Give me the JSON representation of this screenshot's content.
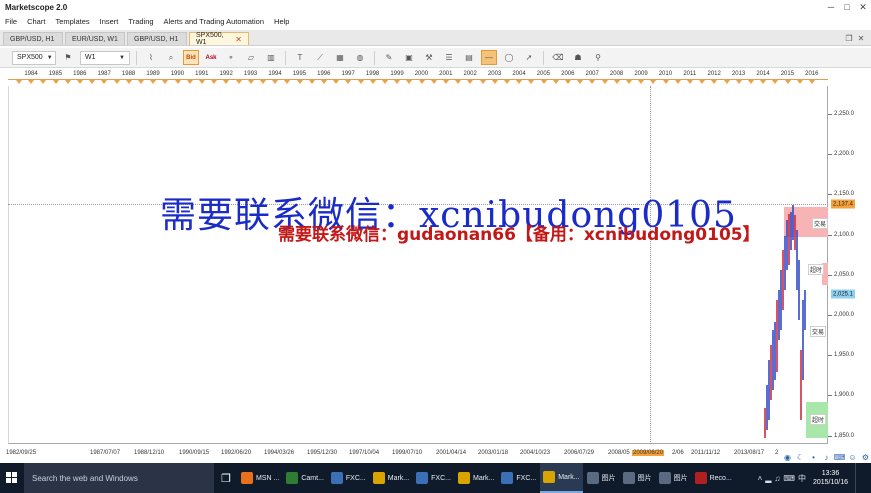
{
  "window": {
    "title": "Marketscope 2.0",
    "controls": [
      "─",
      "□",
      "✕"
    ]
  },
  "menu": [
    "File",
    "Chart",
    "Templates",
    "Insert",
    "Trading",
    "Alerts and Trading Automation",
    "Help"
  ],
  "tabs": [
    {
      "label": "GBP/USD, H1",
      "active": false
    },
    {
      "label": "EUR/USD, W1",
      "active": false
    },
    {
      "label": "GBP/USD, H1",
      "active": false
    },
    {
      "label": "SPX500, W1",
      "active": true
    }
  ],
  "tab_close_glyph": "✕",
  "toolbar": {
    "instrument": "SPX500",
    "timeframe": "W1",
    "bid_label": "Bid",
    "ask_label": "Ask"
  },
  "year_axis": [
    "1984",
    "1985",
    "1986",
    "1987",
    "1988",
    "1989",
    "1990",
    "1991",
    "1992",
    "1993",
    "1994",
    "1995",
    "1996",
    "1997",
    "1998",
    "1999",
    "2000",
    "2001",
    "2002",
    "2003",
    "2004",
    "2005",
    "2006",
    "2007",
    "2008",
    "2009",
    "2010",
    "2011",
    "2012",
    "2013",
    "2014",
    "2015",
    "2016"
  ],
  "price_axis": [
    "2,250.0",
    "2,200.0",
    "2,150.0",
    "2,100.0",
    "2,050.0",
    "2,000.0",
    "1,950.0",
    "1,900.0",
    "1,850.0"
  ],
  "price_flags": {
    "high": "2,137.4",
    "current": "2,025.1"
  },
  "date_axis": [
    "1982/09/25",
    "1987/07/07",
    "1988/12/10",
    "1990/09/15",
    "1992/06/20",
    "1994/03/26",
    "1995/12/30",
    "1997/10/04",
    "1999/07/10",
    "2001/04/14",
    "2003/01/18",
    "2004/10/23",
    "2006/07/29",
    "2008/05",
    "2009/06/20",
    "2/06",
    "2011/11/12",
    "2013/08/17",
    "2"
  ],
  "side_tags": [
    "交易",
    "超时",
    "交易",
    "超时"
  ],
  "watermark_blue": "需要联系微信：xcnibudong0105",
  "watermark_red": "需要联系微信：gudaonan66【备用：xcnibudong0105】",
  "taskbar": {
    "search_placeholder": "Search the web and Windows",
    "apps": [
      {
        "label": "MSN ...",
        "color": "#e9711c",
        "active": false
      },
      {
        "label": "Camt...",
        "color": "#2f7d32",
        "active": false
      },
      {
        "label": "FXC...",
        "color": "#3b6fb6",
        "active": false
      },
      {
        "label": "Mark...",
        "color": "#d9a400",
        "active": false
      },
      {
        "label": "FXC...",
        "color": "#3b6fb6",
        "active": false
      },
      {
        "label": "Mark...",
        "color": "#d9a400",
        "active": false
      },
      {
        "label": "FXC...",
        "color": "#3b6fb6",
        "active": false
      },
      {
        "label": "Mark...",
        "color": "#d9a400",
        "active": true
      },
      {
        "label": "图片",
        "color": "#5a6a80",
        "active": false
      },
      {
        "label": "图片",
        "color": "#5a6a80",
        "active": false
      },
      {
        "label": "图片",
        "color": "#5a6a80",
        "active": false
      },
      {
        "label": "Reco...",
        "color": "#b02020",
        "active": false
      }
    ],
    "time": "13:36",
    "date": "2015/10/16"
  },
  "colors": {
    "accent_orange": "#f6a23a",
    "current_price": "#8fd0f0",
    "candle_up": "#3048c8",
    "candle_down": "#d02838"
  }
}
